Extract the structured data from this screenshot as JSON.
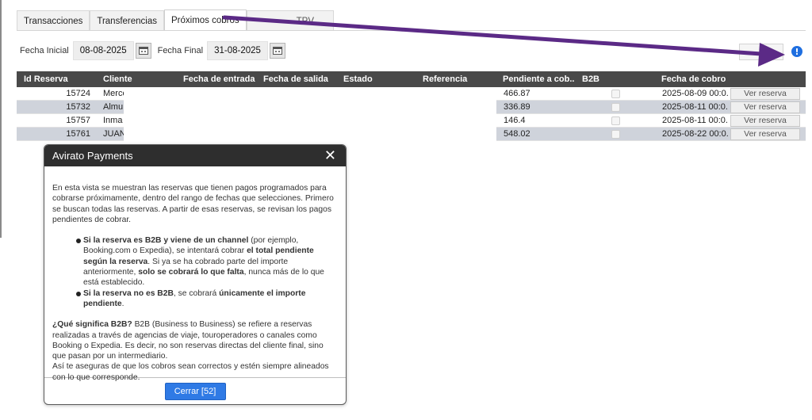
{
  "tabs": [
    {
      "label": "Transacciones"
    },
    {
      "label": "Transferencias"
    },
    {
      "label": "Próximos cobros"
    },
    {
      "label": "TPV"
    }
  ],
  "filters": {
    "start_label": "Fecha Inicial",
    "start_value": "08-08-2025",
    "end_label": "Fecha Final",
    "end_value": "31-08-2025"
  },
  "table": {
    "headers": [
      "Id Reserva",
      "Cliente",
      "Fecha de entrada",
      "Fecha de salida",
      "Estado",
      "Referencia",
      "Pendiente a cob...",
      "B2B",
      "Fecha de cobro"
    ],
    "rows": [
      {
        "id": "15724",
        "client": "Merce",
        "pending": "466.87",
        "b2b": false,
        "date": "2025-08-09 00:0...",
        "action": "Ver reserva"
      },
      {
        "id": "15732",
        "client": "Almu",
        "pending": "336.89",
        "b2b": false,
        "date": "2025-08-11 00:0...",
        "action": "Ver reserva"
      },
      {
        "id": "15757",
        "client": "Inma",
        "pending": "146.4",
        "b2b": false,
        "date": "2025-08-11 00:0...",
        "action": "Ver reserva"
      },
      {
        "id": "15761",
        "client": "JUAN",
        "pending": "548.02",
        "b2b": false,
        "date": "2025-08-22 00:0...",
        "action": "Ver reserva"
      }
    ]
  },
  "dialog": {
    "title": "Avirato Payments",
    "intro": "En esta vista se muestran las reservas que tienen pagos programados para cobrarse próximamente, dentro del rango de fechas que selecciones. Primero se buscan todas las reservas. A partir de esas reservas, se revisan los pagos pendientes de cobrar.",
    "bullet1": {
      "b1": "Si la reserva es B2B y viene de un channel",
      "t1": " (por ejemplo, Booking.com o Expedia), se intentará cobrar ",
      "b2": "el total pendiente según la reserva",
      "t2": ". Si ya se ha cobrado parte del importe anteriormente, ",
      "b3": "solo se cobrará lo que falta",
      "t3": ", nunca más de lo que está establecido."
    },
    "bullet2": {
      "b1": "Si la reserva no es B2B",
      "t1": ", se cobrará ",
      "b2": "únicamente el importe pendiente",
      "t2": "."
    },
    "b2b_q": "¿Qué significa B2B?",
    "b2b_text": " B2B (Business to Business) se refiere a reservas realizadas a través de agencias de viaje, touroperadores o canales como Booking o Expedia. Es decir, no son reservas directas del cliente final, sino que pasan por un intermediario.",
    "closing": "Así te aseguras de que los cobros sean correctos y estén siempre alineados con lo que corresponde.",
    "close_button": "Cerrar [52]"
  },
  "colors": {
    "header_bg": "#494949",
    "dialog_header_bg": "#2e2e2e",
    "primary_button": "#2f7ae5",
    "info_icon": "#1f6fe0",
    "arrow": "#5b2a86",
    "alt_row": "#cfd3db"
  },
  "icons": [
    "calendar-icon",
    "info-icon",
    "close-icon",
    "annotation-arrow"
  ]
}
